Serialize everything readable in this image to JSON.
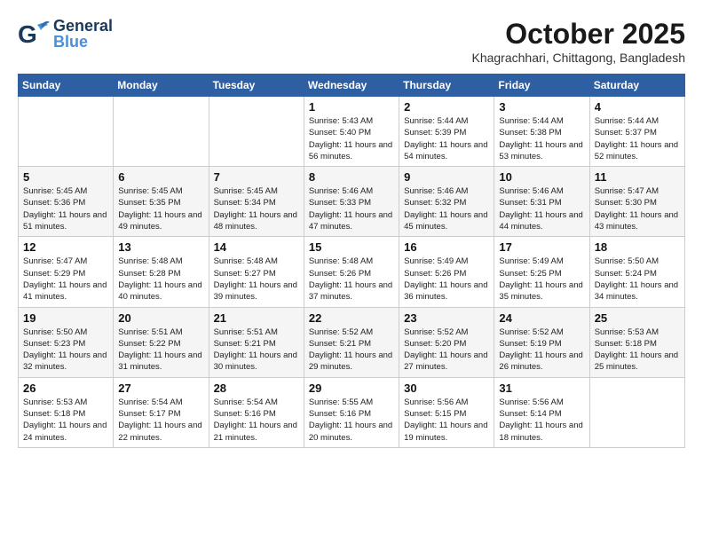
{
  "logo": {
    "text1": "General",
    "text2": "Blue"
  },
  "title": "October 2025",
  "location": "Khagrachhari, Chittagong, Bangladesh",
  "weekdays": [
    "Sunday",
    "Monday",
    "Tuesday",
    "Wednesday",
    "Thursday",
    "Friday",
    "Saturday"
  ],
  "weeks": [
    [
      {
        "day": "",
        "sunrise": "",
        "sunset": "",
        "daylight": ""
      },
      {
        "day": "",
        "sunrise": "",
        "sunset": "",
        "daylight": ""
      },
      {
        "day": "",
        "sunrise": "",
        "sunset": "",
        "daylight": ""
      },
      {
        "day": "1",
        "sunrise": "Sunrise: 5:43 AM",
        "sunset": "Sunset: 5:40 PM",
        "daylight": "Daylight: 11 hours and 56 minutes."
      },
      {
        "day": "2",
        "sunrise": "Sunrise: 5:44 AM",
        "sunset": "Sunset: 5:39 PM",
        "daylight": "Daylight: 11 hours and 54 minutes."
      },
      {
        "day": "3",
        "sunrise": "Sunrise: 5:44 AM",
        "sunset": "Sunset: 5:38 PM",
        "daylight": "Daylight: 11 hours and 53 minutes."
      },
      {
        "day": "4",
        "sunrise": "Sunrise: 5:44 AM",
        "sunset": "Sunset: 5:37 PM",
        "daylight": "Daylight: 11 hours and 52 minutes."
      }
    ],
    [
      {
        "day": "5",
        "sunrise": "Sunrise: 5:45 AM",
        "sunset": "Sunset: 5:36 PM",
        "daylight": "Daylight: 11 hours and 51 minutes."
      },
      {
        "day": "6",
        "sunrise": "Sunrise: 5:45 AM",
        "sunset": "Sunset: 5:35 PM",
        "daylight": "Daylight: 11 hours and 49 minutes."
      },
      {
        "day": "7",
        "sunrise": "Sunrise: 5:45 AM",
        "sunset": "Sunset: 5:34 PM",
        "daylight": "Daylight: 11 hours and 48 minutes."
      },
      {
        "day": "8",
        "sunrise": "Sunrise: 5:46 AM",
        "sunset": "Sunset: 5:33 PM",
        "daylight": "Daylight: 11 hours and 47 minutes."
      },
      {
        "day": "9",
        "sunrise": "Sunrise: 5:46 AM",
        "sunset": "Sunset: 5:32 PM",
        "daylight": "Daylight: 11 hours and 45 minutes."
      },
      {
        "day": "10",
        "sunrise": "Sunrise: 5:46 AM",
        "sunset": "Sunset: 5:31 PM",
        "daylight": "Daylight: 11 hours and 44 minutes."
      },
      {
        "day": "11",
        "sunrise": "Sunrise: 5:47 AM",
        "sunset": "Sunset: 5:30 PM",
        "daylight": "Daylight: 11 hours and 43 minutes."
      }
    ],
    [
      {
        "day": "12",
        "sunrise": "Sunrise: 5:47 AM",
        "sunset": "Sunset: 5:29 PM",
        "daylight": "Daylight: 11 hours and 41 minutes."
      },
      {
        "day": "13",
        "sunrise": "Sunrise: 5:48 AM",
        "sunset": "Sunset: 5:28 PM",
        "daylight": "Daylight: 11 hours and 40 minutes."
      },
      {
        "day": "14",
        "sunrise": "Sunrise: 5:48 AM",
        "sunset": "Sunset: 5:27 PM",
        "daylight": "Daylight: 11 hours and 39 minutes."
      },
      {
        "day": "15",
        "sunrise": "Sunrise: 5:48 AM",
        "sunset": "Sunset: 5:26 PM",
        "daylight": "Daylight: 11 hours and 37 minutes."
      },
      {
        "day": "16",
        "sunrise": "Sunrise: 5:49 AM",
        "sunset": "Sunset: 5:26 PM",
        "daylight": "Daylight: 11 hours and 36 minutes."
      },
      {
        "day": "17",
        "sunrise": "Sunrise: 5:49 AM",
        "sunset": "Sunset: 5:25 PM",
        "daylight": "Daylight: 11 hours and 35 minutes."
      },
      {
        "day": "18",
        "sunrise": "Sunrise: 5:50 AM",
        "sunset": "Sunset: 5:24 PM",
        "daylight": "Daylight: 11 hours and 34 minutes."
      }
    ],
    [
      {
        "day": "19",
        "sunrise": "Sunrise: 5:50 AM",
        "sunset": "Sunset: 5:23 PM",
        "daylight": "Daylight: 11 hours and 32 minutes."
      },
      {
        "day": "20",
        "sunrise": "Sunrise: 5:51 AM",
        "sunset": "Sunset: 5:22 PM",
        "daylight": "Daylight: 11 hours and 31 minutes."
      },
      {
        "day": "21",
        "sunrise": "Sunrise: 5:51 AM",
        "sunset": "Sunset: 5:21 PM",
        "daylight": "Daylight: 11 hours and 30 minutes."
      },
      {
        "day": "22",
        "sunrise": "Sunrise: 5:52 AM",
        "sunset": "Sunset: 5:21 PM",
        "daylight": "Daylight: 11 hours and 29 minutes."
      },
      {
        "day": "23",
        "sunrise": "Sunrise: 5:52 AM",
        "sunset": "Sunset: 5:20 PM",
        "daylight": "Daylight: 11 hours and 27 minutes."
      },
      {
        "day": "24",
        "sunrise": "Sunrise: 5:52 AM",
        "sunset": "Sunset: 5:19 PM",
        "daylight": "Daylight: 11 hours and 26 minutes."
      },
      {
        "day": "25",
        "sunrise": "Sunrise: 5:53 AM",
        "sunset": "Sunset: 5:18 PM",
        "daylight": "Daylight: 11 hours and 25 minutes."
      }
    ],
    [
      {
        "day": "26",
        "sunrise": "Sunrise: 5:53 AM",
        "sunset": "Sunset: 5:18 PM",
        "daylight": "Daylight: 11 hours and 24 minutes."
      },
      {
        "day": "27",
        "sunrise": "Sunrise: 5:54 AM",
        "sunset": "Sunset: 5:17 PM",
        "daylight": "Daylight: 11 hours and 22 minutes."
      },
      {
        "day": "28",
        "sunrise": "Sunrise: 5:54 AM",
        "sunset": "Sunset: 5:16 PM",
        "daylight": "Daylight: 11 hours and 21 minutes."
      },
      {
        "day": "29",
        "sunrise": "Sunrise: 5:55 AM",
        "sunset": "Sunset: 5:16 PM",
        "daylight": "Daylight: 11 hours and 20 minutes."
      },
      {
        "day": "30",
        "sunrise": "Sunrise: 5:56 AM",
        "sunset": "Sunset: 5:15 PM",
        "daylight": "Daylight: 11 hours and 19 minutes."
      },
      {
        "day": "31",
        "sunrise": "Sunrise: 5:56 AM",
        "sunset": "Sunset: 5:14 PM",
        "daylight": "Daylight: 11 hours and 18 minutes."
      },
      {
        "day": "",
        "sunrise": "",
        "sunset": "",
        "daylight": ""
      }
    ]
  ]
}
